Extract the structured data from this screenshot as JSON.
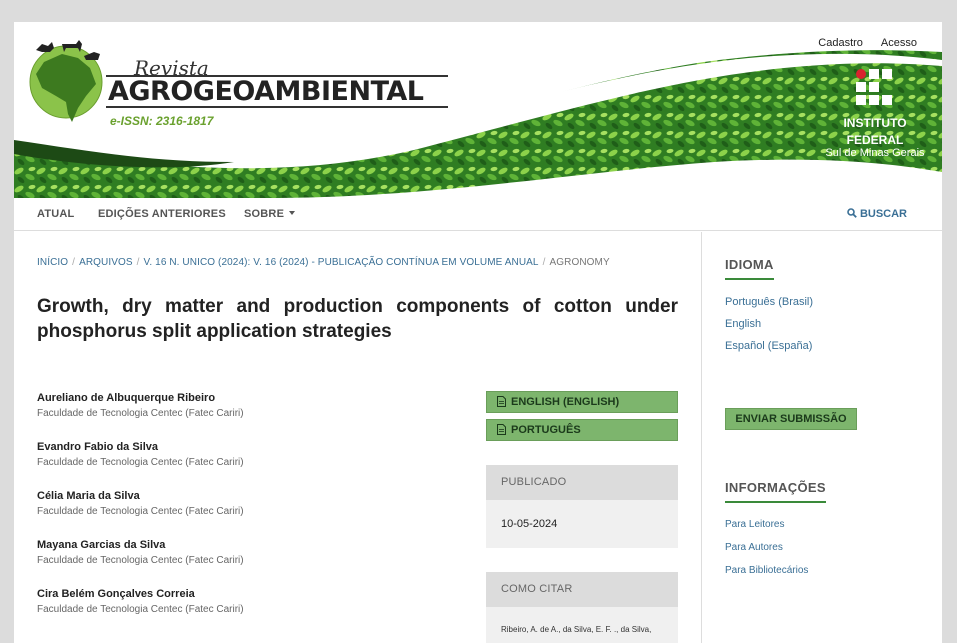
{
  "header": {
    "user_nav": {
      "register": "Cadastro",
      "login": "Acesso"
    },
    "logo": {
      "revista": "Revista",
      "title": "AGROGEOAMBIENTAL",
      "issn": "e-ISSN: 2316-1817"
    },
    "institute": {
      "line1": "INSTITUTO",
      "line2": "FEDERAL",
      "line3": "Sul de Minas Gerais"
    }
  },
  "nav": {
    "current": "ATUAL",
    "archives": "EDIÇÕES ANTERIORES",
    "about": "SOBRE",
    "search": "BUSCAR"
  },
  "breadcrumb": {
    "home": "INÍCIO",
    "archives": "ARQUIVOS",
    "issue": "V. 16 N. UNICO (2024): V. 16 (2024) - PUBLICAÇÃO CONTÍNUA EM VOLUME ANUAL",
    "section": "AGRONOMY"
  },
  "article": {
    "title": "Growth, dry matter and production components of cotton under phosphorus split application strategies",
    "authors": [
      {
        "name": "Aureliano de Albuquerque Ribeiro",
        "affiliation": "Faculdade de Tecnologia Centec (Fatec Cariri)"
      },
      {
        "name": "Evandro Fabio da Silva",
        "affiliation": "Faculdade de Tecnologia Centec (Fatec Cariri)"
      },
      {
        "name": "Célia Maria da Silva",
        "affiliation": "Faculdade de Tecnologia Centec (Fatec Cariri)"
      },
      {
        "name": "Mayana Garcias da Silva",
        "affiliation": "Faculdade de Tecnologia Centec (Fatec Cariri)"
      },
      {
        "name": "Cira Belém Gonçalves Correia",
        "affiliation": "Faculdade de Tecnologia Centec (Fatec Cariri)"
      }
    ],
    "galleys": {
      "english": "ENGLISH (ENGLISH)",
      "portuguese": "PORTUGUÊS"
    },
    "published": {
      "label": "PUBLICADO",
      "date": "10-05-2024"
    },
    "cite": {
      "label": "COMO CITAR",
      "text": "Ribeiro, A. de A., da Silva, E. F. ., da Silva,"
    }
  },
  "sidebar": {
    "language": {
      "title": "IDIOMA",
      "items": [
        "Português (Brasil)",
        "English",
        "Español (España)"
      ]
    },
    "submit": "ENVIAR SUBMISSÃO",
    "info": {
      "title": "INFORMAÇÕES",
      "items": [
        "Para Leitores",
        "Para Autores",
        "Para Bibliotecários"
      ]
    }
  }
}
